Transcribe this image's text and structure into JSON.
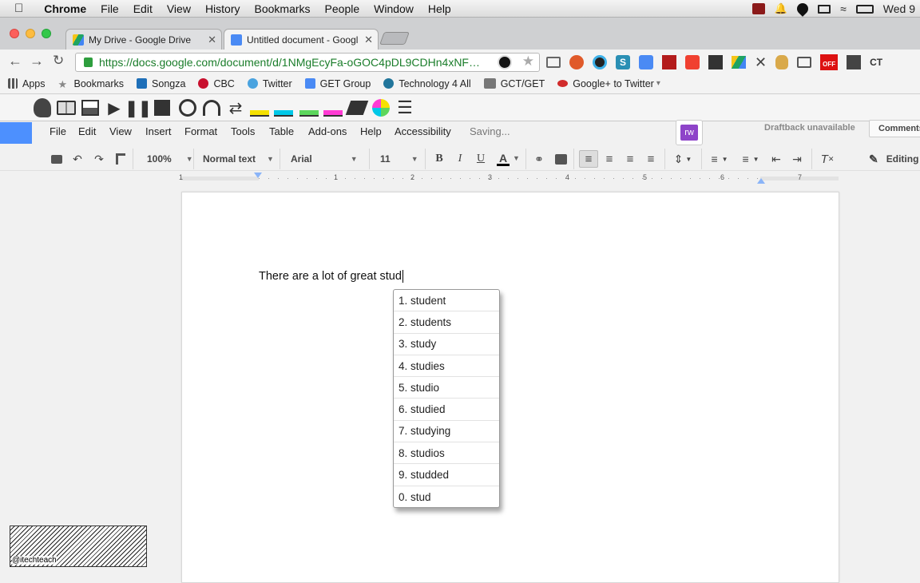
{
  "mac": {
    "menus": [
      "Chrome",
      "File",
      "Edit",
      "View",
      "History",
      "Bookmarks",
      "People",
      "Window",
      "Help"
    ],
    "clock": "Wed 9"
  },
  "tabs": [
    {
      "title": "My Drive - Google Drive"
    },
    {
      "title": "Untitled document - Googl"
    }
  ],
  "address": {
    "url": "https://docs.google.com/document/d/1NMgEcyFa-oGOC4pDL9CDHn4xNF…"
  },
  "bookmarks": [
    "Apps",
    "Bookmarks",
    "Songza",
    "CBC",
    "Twitter",
    "GET Group",
    "Technology 4 All",
    "GCT/GET",
    "Google+ to Twitter"
  ],
  "docs": {
    "menus": [
      "File",
      "Edit",
      "View",
      "Insert",
      "Format",
      "Tools",
      "Table",
      "Add-ons",
      "Help",
      "Accessibility"
    ],
    "status": "Saving...",
    "draftback": "Draftback unavailable",
    "comments": "Comments",
    "editing": "Editing",
    "rw_badge": "rw",
    "toolbar": {
      "zoom": "100%",
      "style": "Normal text",
      "font": "Arial",
      "size": "11",
      "bold": "B",
      "italic": "I",
      "underline": "U",
      "text_color": "A"
    },
    "ruler": [
      "1",
      "1",
      "2",
      "3",
      "4",
      "5",
      "6",
      "7"
    ]
  },
  "document": {
    "text": "There are a lot of great stud"
  },
  "predictions": [
    "1. student",
    "2. students",
    "3. study",
    "4. studies",
    "5. studio",
    "6. studied",
    "7. studying",
    "8. studios",
    "9. studded",
    "0. stud"
  ],
  "watermark": "@itechteach",
  "colors": {
    "accent_blue": "#4d90fe",
    "rw_purple": "#8e44c9",
    "highlight_yellow": "#f5e100",
    "highlight_cyan": "#00c8e8",
    "highlight_pink": "#ff3bd4"
  }
}
